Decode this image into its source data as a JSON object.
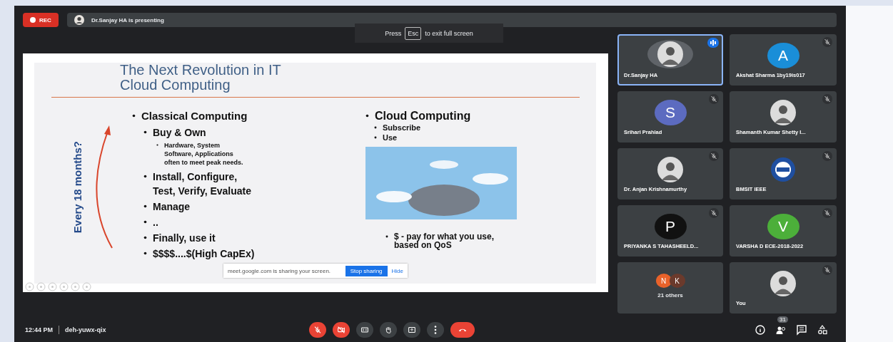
{
  "recording": {
    "label": "REC"
  },
  "presenter_bar": {
    "text": "Dr.Sanjay HA is presenting"
  },
  "fullscreen_hint": {
    "before": "Press",
    "key": "Esc",
    "after": "to exit full screen"
  },
  "slide": {
    "title_lines": [
      "The Next Revolution in IT",
      "Cloud Computing"
    ],
    "side_label": "Every 18 months?",
    "left_items": [
      {
        "text": "Classical Computing",
        "children": [
          {
            "text": "Buy & Own",
            "children": [
              {
                "text": "Hardware, System Software, Applications often to meet peak needs."
              }
            ]
          },
          {
            "text": "Install, Configure, Test, Verify, Evaluate"
          },
          {
            "text": "Manage"
          },
          {
            "text": ".."
          },
          {
            "text": "Finally, use it"
          },
          {
            "text": "$$$$....$(High CapEx)"
          }
        ]
      }
    ],
    "right_blocks": [
      {
        "kind": "list",
        "items": [
          {
            "text": "Cloud Computing",
            "children": [
              {
                "text": "Subscribe"
              },
              {
                "text": "Use"
              }
            ]
          }
        ]
      },
      {
        "kind": "picture"
      },
      {
        "kind": "note",
        "items": [
          {
            "text": "$ - pay for what you use, based on QoS"
          }
        ]
      }
    ]
  },
  "share_banner": {
    "text": "meet.google.com is sharing your screen.",
    "stop": "Stop sharing",
    "hide": "Hide"
  },
  "participants": [
    {
      "name": "Dr.Sanjay HA",
      "kind": "photo",
      "speaking": true,
      "muted": false
    },
    {
      "name": "Akshat Sharma 1by19is017",
      "kind": "letter",
      "letter": "A",
      "color": "#1a8ed8",
      "speaking": false,
      "muted": true
    },
    {
      "name": "Srihari Prahlad",
      "kind": "letter",
      "letter": "S",
      "color": "#5c6bc0",
      "speaking": false,
      "muted": true
    },
    {
      "name": "Shamanth Kumar Shetty I...",
      "kind": "photo",
      "speaking": false,
      "muted": true
    },
    {
      "name": "Dr. Anjan Krishnamurthy",
      "kind": "photo",
      "speaking": false,
      "muted": true
    },
    {
      "name": "BMSIT IEEE",
      "kind": "logo",
      "speaking": false,
      "muted": true
    },
    {
      "name": "PRIYANKA S TAHASHEELD...",
      "kind": "letter",
      "letter": "P",
      "color": "#111111",
      "speaking": false,
      "muted": true
    },
    {
      "name": "VARSHA D ECE-2018-2022",
      "kind": "letter",
      "letter": "V",
      "color": "#4caf3a",
      "speaking": false,
      "muted": true
    },
    {
      "name": "21 others",
      "kind": "others",
      "letters": [
        {
          "letter": "N",
          "color": "#e8622a"
        },
        {
          "letter": "K",
          "color": "#6b3a2c"
        }
      ],
      "speaking": false,
      "muted": false
    },
    {
      "name": "You",
      "kind": "photo",
      "speaking": false,
      "muted": true
    }
  ],
  "bottom_bar": {
    "time": "12:44 PM",
    "meeting_code": "deh-yuwx-qix",
    "controls": [
      {
        "kind": "mic",
        "on": false
      },
      {
        "kind": "camera",
        "on": false
      },
      {
        "kind": "captions",
        "on": false
      },
      {
        "kind": "hand",
        "on": false
      },
      {
        "kind": "present",
        "on": false
      },
      {
        "kind": "more",
        "on": false
      },
      {
        "kind": "leave"
      }
    ],
    "side_buttons": [
      {
        "kind": "info"
      },
      {
        "kind": "people",
        "badge": "31"
      },
      {
        "kind": "chat"
      },
      {
        "kind": "activities"
      }
    ]
  }
}
